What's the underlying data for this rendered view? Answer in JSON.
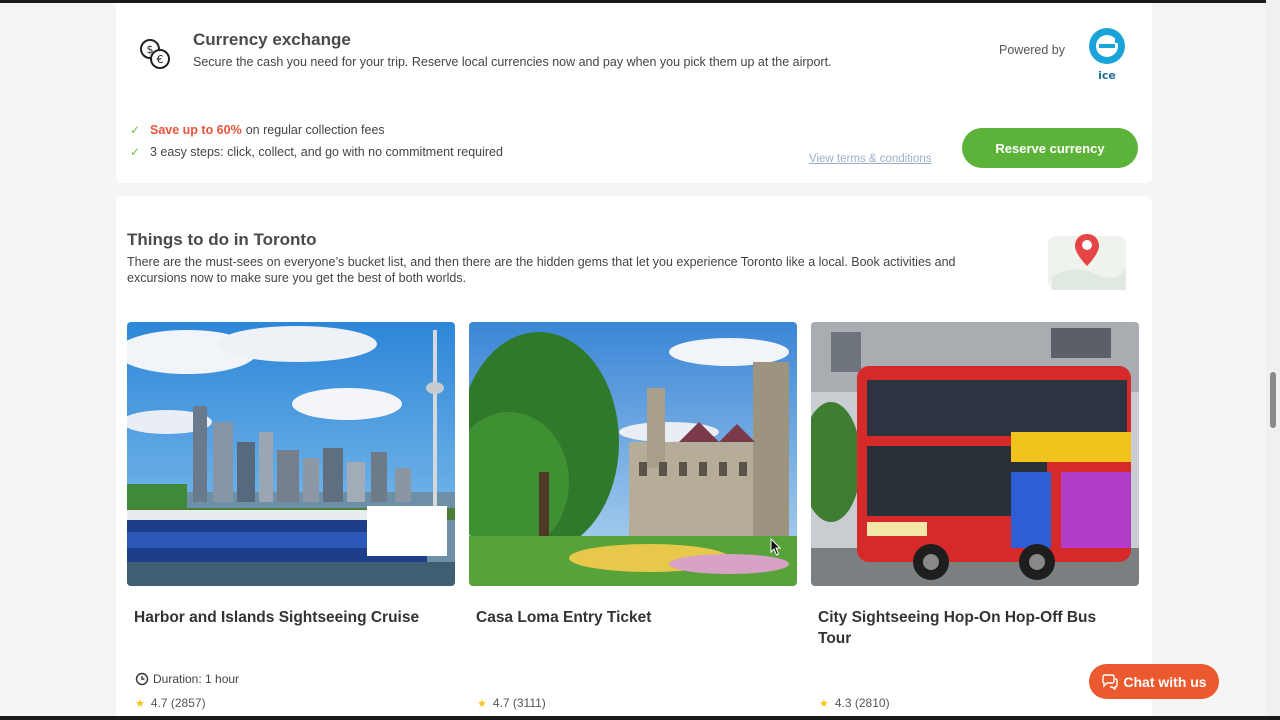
{
  "currency": {
    "title": "Currency exchange",
    "description": "Secure the cash you need for your trip. Reserve local currencies now and pay when you pick them up at the airport.",
    "powered_by": "Powered by",
    "logo_text": "ice",
    "bullet1_highlight": "Save up to 60%",
    "bullet1_rest": "on regular collection fees",
    "bullet2": "3 easy steps: click, collect, and go with no commitment required",
    "terms_link": "View terms & conditions",
    "reserve_button": "Reserve currency"
  },
  "things": {
    "title": "Things to do in Toronto",
    "description": "There are the must-sees on everyone’s bucket list, and then there are the hidden gems that let you experience Toronto like a local. Book activities and excursions now to make sure you get the best of both worlds.",
    "tiles": [
      {
        "title": "Harbor and Islands Sightseeing Cruise",
        "duration": "Duration: 1 hour",
        "rating": "4.7 (2857)"
      },
      {
        "title": "Casa Loma Entry Ticket",
        "rating": "4.7 (3111)"
      },
      {
        "title": "City Sightseeing Hop-On Hop-Off Bus Tour",
        "rating": "4.3 (2810)"
      }
    ]
  },
  "chat": {
    "label": "Chat with us"
  },
  "colors": {
    "accent_green": "#5db33a",
    "accent_orange": "#ea5a2e",
    "highlight_red": "#e8553a",
    "ice_blue": "#1aa3d9"
  }
}
